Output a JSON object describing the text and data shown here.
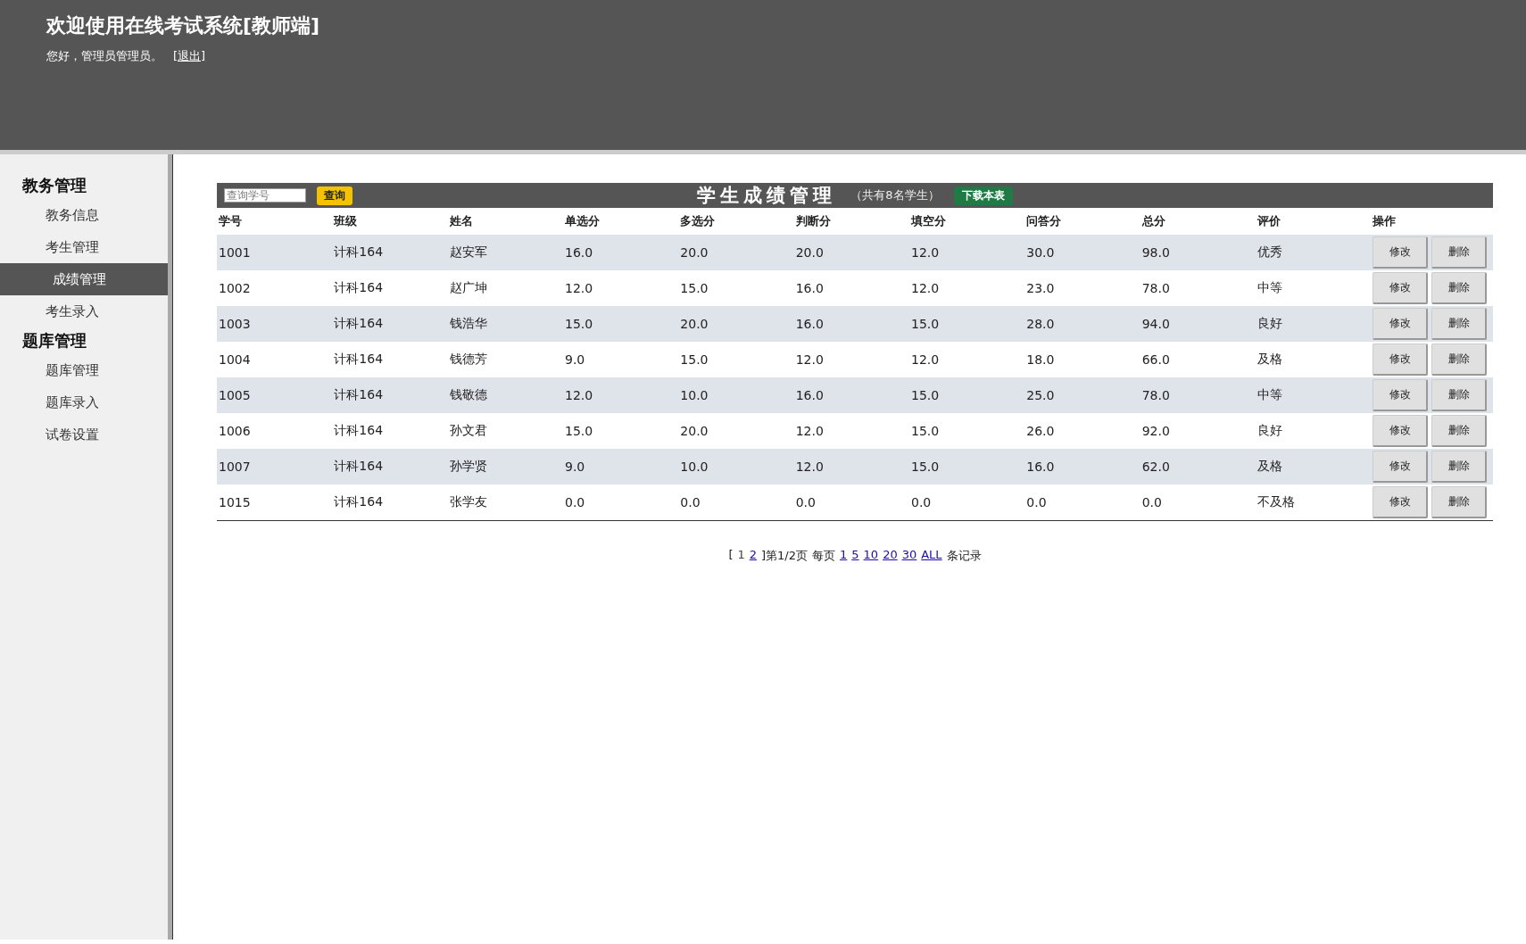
{
  "header": {
    "title": "欢迎使用在线考试系统[教师端]",
    "greeting": "您好，管理员管理员。",
    "logout": "[退出]"
  },
  "sidebar": {
    "groups": [
      {
        "title": "教务管理",
        "items": [
          {
            "label": "教务信息",
            "selected": false
          },
          {
            "label": "考生管理",
            "selected": false
          },
          {
            "label": "成绩管理",
            "selected": true
          },
          {
            "label": "考生录入",
            "selected": false
          }
        ]
      },
      {
        "title": "题库管理",
        "items": [
          {
            "label": "题库管理",
            "selected": false
          },
          {
            "label": "题库录入",
            "selected": false
          },
          {
            "label": "试卷设置",
            "selected": false
          }
        ]
      }
    ]
  },
  "toolbar": {
    "search": {
      "placeholder": "查询学号"
    },
    "search_button": "查询",
    "title": "学生成绩管理",
    "count": "（共有8名学生）",
    "download_button": "下载本表"
  },
  "table": {
    "columns": [
      "学号",
      "班级",
      "姓名",
      "单选分",
      "多选分",
      "判断分",
      "填空分",
      "问答分",
      "总分",
      "评价",
      "操作"
    ],
    "rows": [
      {
        "cells": [
          "1001",
          "计科164",
          "赵安军",
          "16.0",
          "20.0",
          "20.0",
          "12.0",
          "30.0",
          "98.0",
          "优秀"
        ],
        "actions": [
          "修改",
          "删除"
        ]
      },
      {
        "cells": [
          "1002",
          "计科164",
          "赵广坤",
          "12.0",
          "15.0",
          "16.0",
          "12.0",
          "23.0",
          "78.0",
          "中等"
        ],
        "actions": [
          "修改",
          "删除"
        ]
      },
      {
        "cells": [
          "1003",
          "计科164",
          "钱浩华",
          "15.0",
          "20.0",
          "16.0",
          "15.0",
          "28.0",
          "94.0",
          "良好"
        ],
        "actions": [
          "修改",
          "删除"
        ]
      },
      {
        "cells": [
          "1004",
          "计科164",
          "钱德芳",
          "9.0",
          "15.0",
          "12.0",
          "12.0",
          "18.0",
          "66.0",
          "及格"
        ],
        "actions": [
          "修改",
          "删除"
        ]
      },
      {
        "cells": [
          "1005",
          "计科164",
          "钱敬德",
          "12.0",
          "10.0",
          "16.0",
          "15.0",
          "25.0",
          "78.0",
          "中等"
        ],
        "actions": [
          "修改",
          "删除"
        ]
      },
      {
        "cells": [
          "1006",
          "计科164",
          "孙文君",
          "15.0",
          "20.0",
          "12.0",
          "15.0",
          "26.0",
          "92.0",
          "良好"
        ],
        "actions": [
          "修改",
          "删除"
        ]
      },
      {
        "cells": [
          "1007",
          "计科164",
          "孙学贤",
          "9.0",
          "10.0",
          "12.0",
          "15.0",
          "16.0",
          "62.0",
          "及格"
        ],
        "actions": [
          "修改",
          "删除"
        ]
      },
      {
        "cells": [
          "1015",
          "计科164",
          "张学友",
          "0.0",
          "0.0",
          "0.0",
          "0.0",
          "0.0",
          "0.0",
          "不及格"
        ],
        "actions": [
          "修改",
          "删除"
        ]
      }
    ]
  },
  "pagination": {
    "open": "[",
    "pages": [
      {
        "label": "1",
        "selected": true
      },
      {
        "label": "2",
        "selected": false
      }
    ],
    "close": "]第1/2页",
    "per_page_label": "每页",
    "sizes": [
      "1",
      "5",
      "10",
      "20",
      "30",
      "ALL"
    ],
    "suffix": "条记录"
  }
}
